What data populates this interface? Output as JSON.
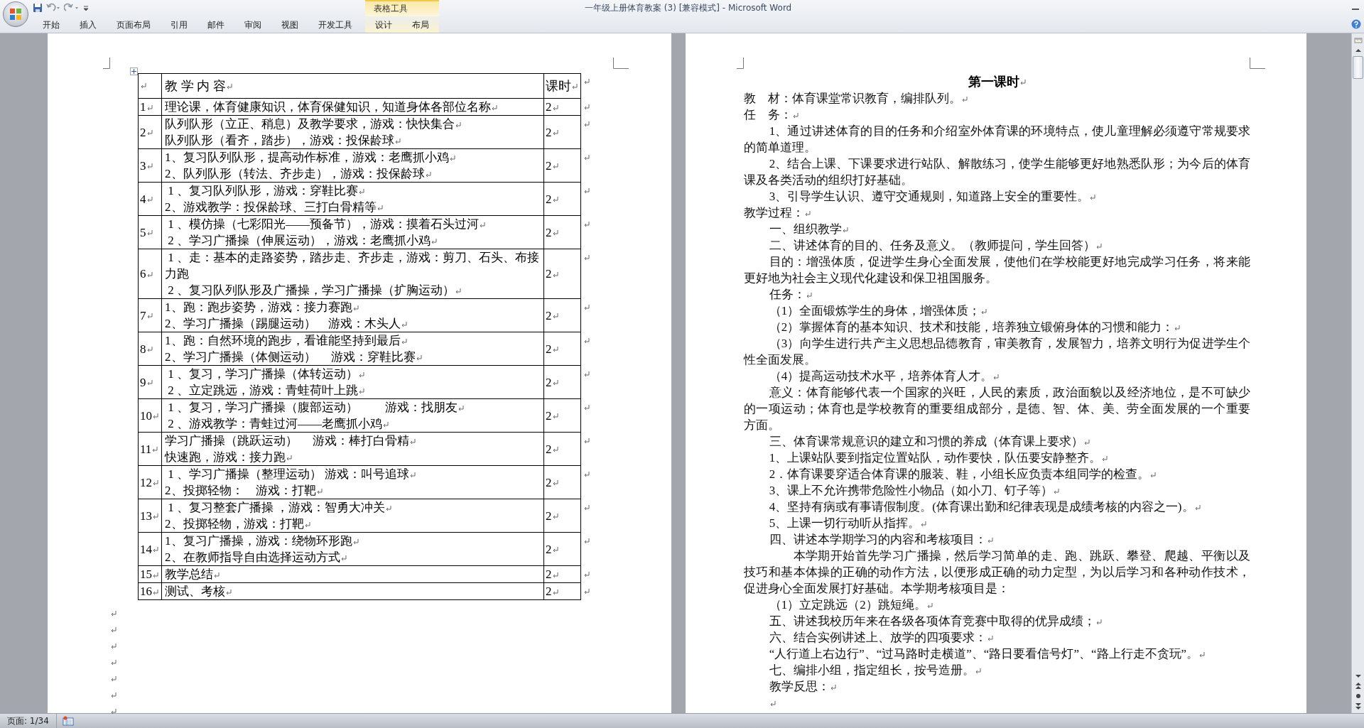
{
  "window": {
    "title": "一年级上册体育教案 (3) [兼容模式] - Microsoft Word"
  },
  "contextual_group": {
    "label": "表格工具"
  },
  "ribbon_tabs": [
    {
      "label": "开始",
      "kind": "standard"
    },
    {
      "label": "插入",
      "kind": "standard"
    },
    {
      "label": "页面布局",
      "kind": "standard"
    },
    {
      "label": "引用",
      "kind": "standard"
    },
    {
      "label": "邮件",
      "kind": "standard"
    },
    {
      "label": "审阅",
      "kind": "standard"
    },
    {
      "label": "视图",
      "kind": "standard"
    },
    {
      "label": "开发工具",
      "kind": "standard"
    },
    {
      "label": "设计",
      "kind": "contextual"
    },
    {
      "label": "布局",
      "kind": "contextual"
    }
  ],
  "left_page": {
    "table": {
      "columns": [
        "教 学 内 容",
        "课时"
      ],
      "rows": [
        {
          "number": "1",
          "lines": [
            "理论课，体育健康知识，体育保健知识，知道身体各部位名称"
          ],
          "hours": "2"
        },
        {
          "number": "2",
          "lines": [
            "队列队形（立正、稍息）及教学要求，游戏：快快集合",
            "队列队形（看齐，踏步），游戏：投保龄球"
          ],
          "hours": "2"
        },
        {
          "number": "3",
          "lines": [
            "1、复习队列队形，提高动作标准，游戏：老鹰抓小鸡",
            "2、队列队形（转法、齐步走），游戏：投保龄球"
          ],
          "hours": "2"
        },
        {
          "number": "4",
          "lines": [
            " 1 、复习队列队形，游戏：穿鞋比赛",
            "2、游戏教学：投保龄球、三打白骨精等"
          ],
          "hours": "2"
        },
        {
          "number": "5",
          "lines": [
            " 1 、模仿操（七彩阳光——预备节），游戏：摸着石头过河",
            " 2 、学习广播操（伸展运动），游戏：老鹰抓小鸡"
          ],
          "hours": "2"
        },
        {
          "number": "6",
          "lines": [
            " 1 、走：基本的走路姿势，踏步走、齐步走，游戏：剪刀、石头、布接力跑",
            " 2 、复习队列队形及广播操，学习广播操（扩胸运动）"
          ],
          "hours": "2"
        },
        {
          "number": "7",
          "lines": [
            "1、跑：跑步姿势，游戏：接力赛跑",
            "2、学习广播操（踢腿运动）　游戏：木头人"
          ],
          "hours": "2"
        },
        {
          "number": "8",
          "lines": [
            "1、跑：自然环境的跑步，看谁能坚持到最后",
            "2、学习广播操（体侧运动）　 游戏：穿鞋比赛"
          ],
          "hours": "2"
        },
        {
          "number": "9",
          "lines": [
            " 1 、复习，学习广播操（体转运动）",
            " 2 、立定跳远，游戏：青蛙荷叶上跳"
          ],
          "hours": "2"
        },
        {
          "number": "10",
          "lines": [
            " 1 、复习，学习广播操（腹部运动）　　 游戏：找朋友",
            " 2 、游戏教学：青蛙过河——老鹰抓小鸡"
          ],
          "hours": "2"
        },
        {
          "number": "11",
          "lines": [
            "学习广播操（跳跃运动）　 游戏：棒打白骨精",
            "快速跑，游戏：接力跑"
          ],
          "hours": "2"
        },
        {
          "number": "12",
          "lines": [
            " 1 、学习广播操（整理运动） 游戏：叫号追球",
            "2、投掷轻物：　游戏：打靶"
          ],
          "hours": "2"
        },
        {
          "number": "13",
          "lines": [
            " 1 、复习整套广播操 ，游戏：智勇大冲关",
            "2、投掷轻物，游戏：打靶"
          ],
          "hours": "2"
        },
        {
          "number": "14",
          "lines": [
            "1、复习广播操，游戏：绕物环形跑",
            "2、在教师指导自由选择运动方式"
          ],
          "hours": "2"
        },
        {
          "number": "15",
          "lines": [
            "教学总结"
          ],
          "hours": "2"
        },
        {
          "number": "16",
          "lines": [
            "测试、考核"
          ],
          "hours": "2"
        }
      ]
    },
    "trailing_paragraphs": [
      {
        "kind": "empty"
      },
      {
        "kind": "empty"
      },
      {
        "kind": "empty"
      },
      {
        "kind": "empty"
      },
      {
        "kind": "empty"
      },
      {
        "kind": "empty"
      },
      {
        "kind": "empty"
      }
    ]
  },
  "right_page": {
    "title": "第一课时",
    "paragraphs": [
      {
        "kind": "flush",
        "text": "教　材：体育课堂常识教育，编排队列。"
      },
      {
        "kind": "flush",
        "text": "任　务："
      },
      {
        "kind": "indent",
        "text": "1、通过讲述体育的目的任务和介绍室外体育课的环境特点，使儿童理解必须遵守常规要求的简单道理。"
      },
      {
        "kind": "indent",
        "text": "2、结合上课、下课要求进行站队、解散练习，使学生能够更好地熟悉队形；为今后的体育课及各类活动的组织打好基础。"
      },
      {
        "kind": "indent",
        "text": "3、引导学生认识、遵守交通规则，知道路上安全的重要性。"
      },
      {
        "kind": "flush",
        "text": "教学过程："
      },
      {
        "kind": "indent",
        "text": "一、组织教学"
      },
      {
        "kind": "indent",
        "text": "二、讲述体育的目的、任务及意义。（教师提问，学生回答）"
      },
      {
        "kind": "indent",
        "text": "目的：增强体质，促进学生身心全面发展，使他们在学校能更好地完成学习任务，将来能更好地为社会主义现代化建设和保卫祖国服务。"
      },
      {
        "kind": "indent",
        "text": "任务："
      },
      {
        "kind": "indent",
        "text": "（1）全面锻炼学生的身体，增强体质；"
      },
      {
        "kind": "indent",
        "text": "（2）掌握体育的基本知识、技术和技能，培养独立锻俯身体的习惯和能力："
      },
      {
        "kind": "indent",
        "text": "（3）向学生进行共产主义思想品德教育，审美教育，发展智力，培养文明行为促进学生个性全面发展。"
      },
      {
        "kind": "indent",
        "text": "（4）提高运动技术水平，培养体育人才。"
      },
      {
        "kind": "indent",
        "text": "意义：体育能够代表一个国家的兴旺，人民的素质，政治面貌以及经济地位，是不可缺少的一项运动；体育也是学校教育的重要组成部分，是德、智、体、美、劳全面发展的一个重要方面。"
      },
      {
        "kind": "indent",
        "text": "三、体育课常规意识的建立和习惯的养成（体育课上要求）"
      },
      {
        "kind": "indent",
        "text": "1、上课站队要到指定位置站队，动作要快，队伍要安静整齐。"
      },
      {
        "kind": "indent",
        "text": "2．体育课要穿适合体育课的服装、鞋，小组长应负责本组同学的检查。"
      },
      {
        "kind": "indent",
        "text": "3、课上不允许携带危险性小物品（如小刀、钉子等）"
      },
      {
        "kind": "indent",
        "text": "4、坚持有病或有事请假制度。(体育课出勤和纪律表现是成绩考核的内容之一)。"
      },
      {
        "kind": "indent",
        "text": "5、上课一切行动听从指挥。"
      },
      {
        "kind": "indent",
        "text": "四、讲述本学期学习的内容和考核项目："
      },
      {
        "kind": "deep",
        "text": "本学期开始首先学习广播操，然后学习简单的走、跑、跳跃、攀登、爬越、平衡以及技巧和基本体操的正确的动作方法，以便形成正确的动力定型，为以后学习和各种动作技术，促进身心全面发展打好基础。本学期考核项目是："
      },
      {
        "kind": "indent",
        "text": "（1）立定跳远（2）跳短绳。"
      },
      {
        "kind": "indent",
        "text": "五、讲述我校历年来在各级各项体育竞赛中取得的优异成绩；"
      },
      {
        "kind": "indent",
        "text": "六、结合实例讲述上、放学的四项要求："
      },
      {
        "kind": "indent",
        "text": "“人行道上右边行”、“过马路时走横道”、“路日要看信号灯”、“路上行走不贪玩”。"
      },
      {
        "kind": "indent",
        "text": "七、编排小组，指定组长，按号造册。"
      },
      {
        "kind": "indent",
        "text": "教学反思："
      },
      {
        "kind": "empty"
      }
    ]
  },
  "status_bar": {
    "page": "页面: 1/34"
  }
}
